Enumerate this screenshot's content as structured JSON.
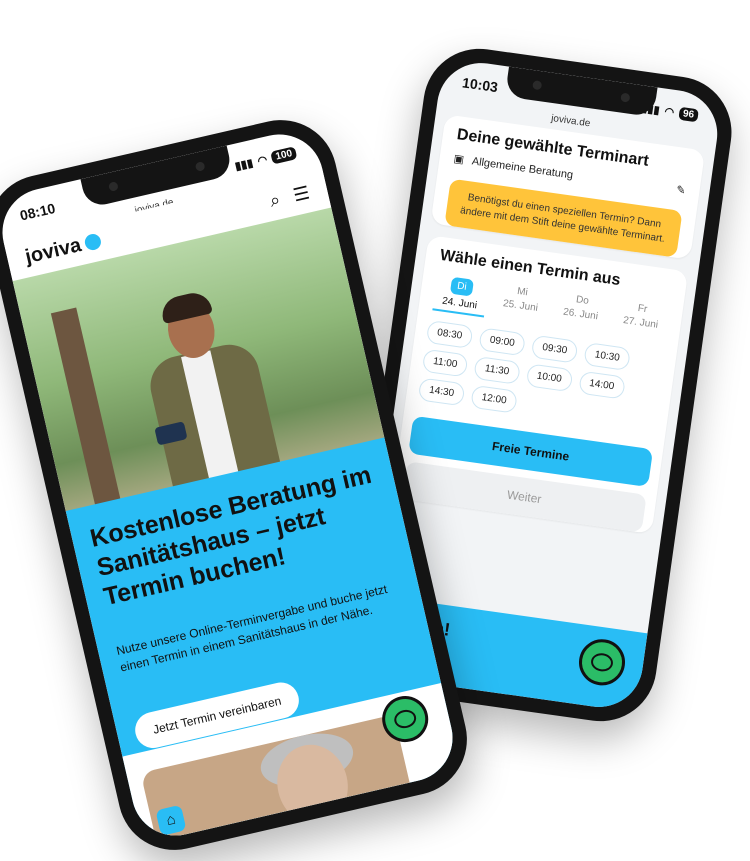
{
  "back_phone": {
    "status": {
      "time": "10:03",
      "battery": "96"
    },
    "url": "joviva.de",
    "selected_type": {
      "title": "Deine gewählte Terminart",
      "type_label": "Allgemeine Beratung",
      "notice": "Benötigst du einen speziellen Termin? Dann ändere mit dem Stift deine gewählte Terminart."
    },
    "picker": {
      "title": "Wähle einen Termin aus",
      "days": [
        {
          "name": "Di",
          "date": "24. Juni",
          "active": true
        },
        {
          "name": "Mi",
          "date": "25. Juni"
        },
        {
          "name": "Do",
          "date": "26. Juni"
        },
        {
          "name": "Fr",
          "date": "27. Juni"
        }
      ],
      "slots": [
        "08:30",
        "09:00",
        "09:30",
        "10:30",
        "11:00",
        "11:30",
        "10:00",
        "14:00",
        "14:30",
        "12:00"
      ],
      "free_button": "Freie Termine",
      "next_button": "Weiter"
    },
    "footer_text": "passen!"
  },
  "front_phone": {
    "status": {
      "time": "08:10",
      "battery": "100"
    },
    "url": "joviva.de",
    "logo": "joviva",
    "hero": {
      "title": "Kostenlose Beratung im Sanitätshaus – jetzt Termin buchen!",
      "text": "Nutze unsere Online-Terminvergabe und buche jetzt einen Termin in einem Sanitätshaus in der Nähe.",
      "cta": "Jetzt Termin vereinbaren"
    }
  },
  "colors": {
    "accent": "#29bdf5",
    "notice": "#ffc43a",
    "chat": "#2bbd67"
  },
  "icons": [
    "search-icon",
    "menu-icon",
    "edit-icon",
    "calendar-icon",
    "chat-icon",
    "home-icon"
  ]
}
